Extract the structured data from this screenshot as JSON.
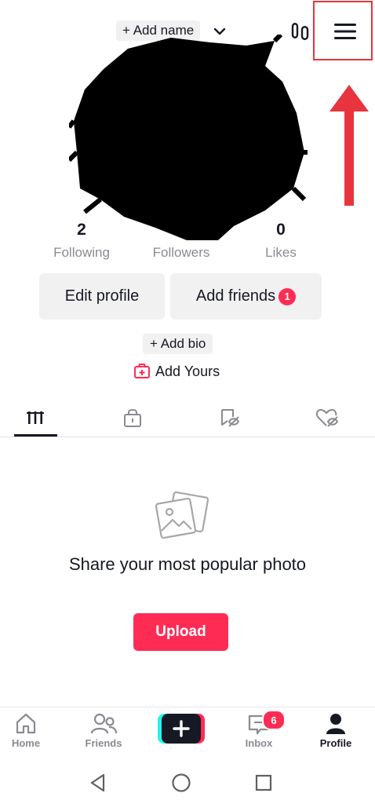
{
  "header": {
    "add_name_label": "+ Add name",
    "icons": [
      "chevron-down-icon",
      "footprint-icon",
      "hamburger-menu-icon"
    ]
  },
  "annotation": {
    "highlight_color": "#e8343d"
  },
  "profile": {
    "stats": [
      {
        "value": "2",
        "label": "Following"
      },
      {
        "value": "",
        "label": "Followers"
      },
      {
        "value": "0",
        "label": "Likes"
      }
    ],
    "edit_profile_label": "Edit profile",
    "add_friends_label": "Add friends",
    "add_friends_badge": "1",
    "add_bio_label": "+ Add bio",
    "add_yours_label": "Add Yours"
  },
  "tabs": [
    "videos-grid-icon",
    "private-lock-icon",
    "reposts-icon",
    "liked-hidden-icon"
  ],
  "empty_state": {
    "title": "Share your most popular photo",
    "upload_label": "Upload"
  },
  "bottom_nav": {
    "items": [
      {
        "label": "Home",
        "icon": "home-icon"
      },
      {
        "label": "Friends",
        "icon": "friends-icon"
      },
      {
        "label": "",
        "icon": "create-plus-icon"
      },
      {
        "label": "Inbox",
        "icon": "inbox-icon"
      },
      {
        "label": "Profile",
        "icon": "profile-icon"
      }
    ],
    "inbox_badge": "6",
    "active": "Profile"
  },
  "colors": {
    "accent": "#fe2c55",
    "text": "#161823",
    "muted": "#8a8b91"
  }
}
